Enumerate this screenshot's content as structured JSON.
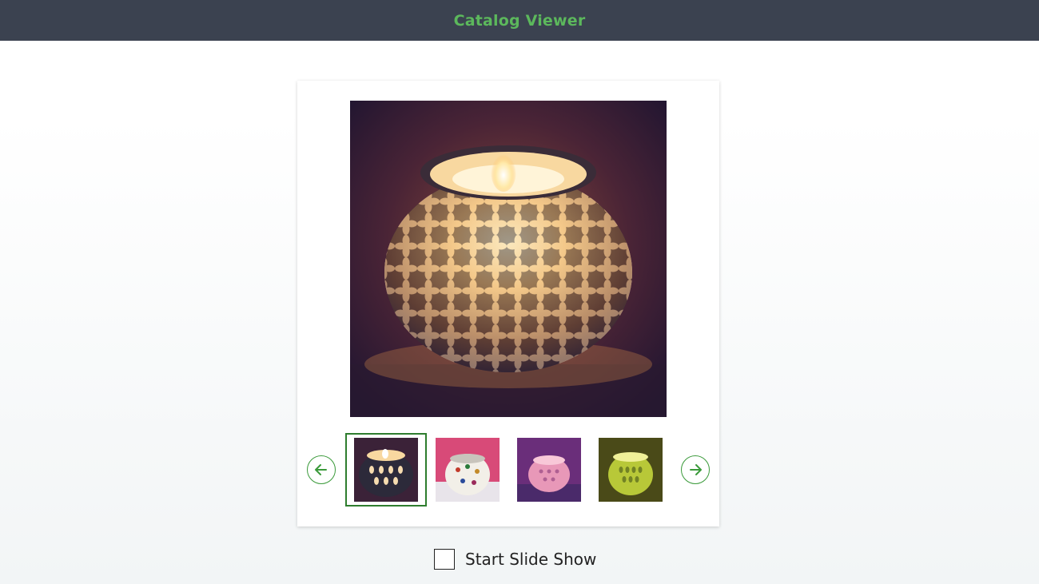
{
  "header": {
    "title": "Catalog Viewer"
  },
  "viewer": {
    "main_image": {
      "subject": "mosaic glass candle holder"
    },
    "prev_icon": "arrow-left-circle-icon",
    "next_icon": "arrow-right-circle-icon",
    "thumbnails": [
      {
        "subject": "mosaic candle holder 1",
        "selected": true
      },
      {
        "subject": "mosaic candle holder 2",
        "selected": false
      },
      {
        "subject": "mosaic candle holder 3",
        "selected": false
      },
      {
        "subject": "mosaic candle holder 4",
        "selected": false
      }
    ]
  },
  "slideshow": {
    "label": "Start Slide Show",
    "checked": false
  },
  "colors": {
    "header_bg": "#3b4250",
    "accent_green": "#5cb85c",
    "selected_border": "#2e7d2e"
  }
}
